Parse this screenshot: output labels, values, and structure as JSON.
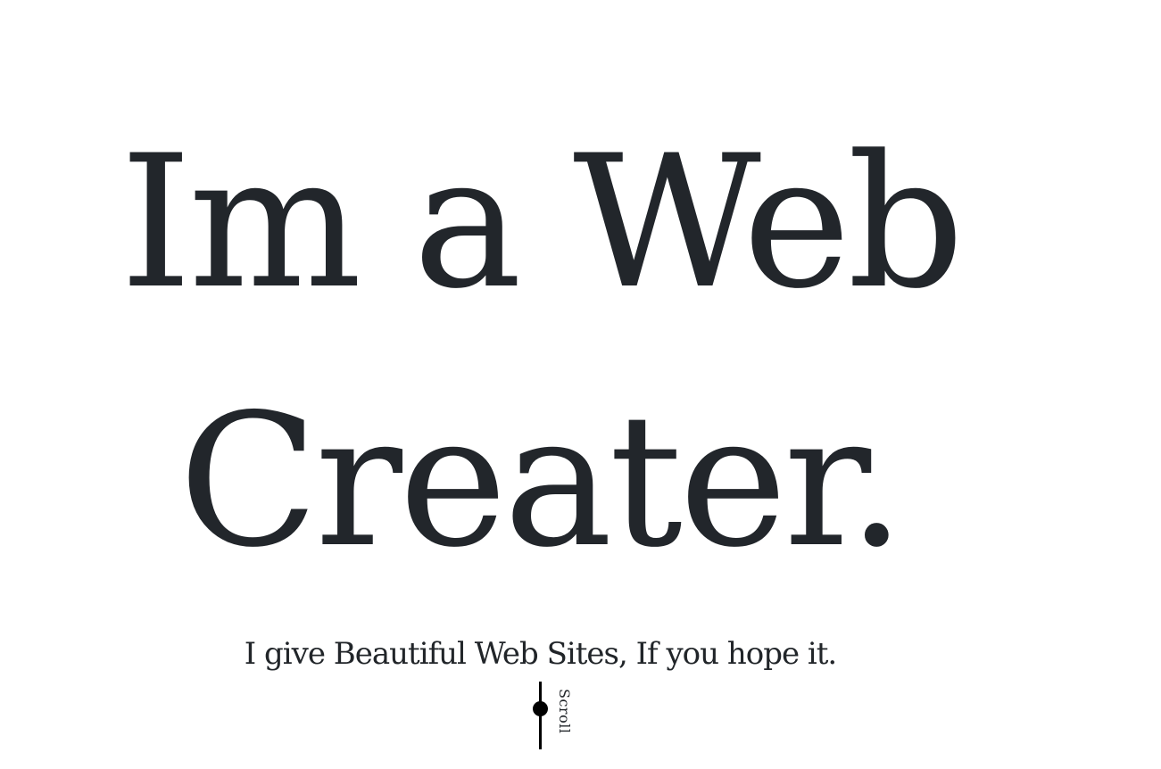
{
  "hero": {
    "headline_line1": "Im a Web",
    "headline_line2": "Creater.",
    "subtitle": "I give Beautiful Web Sites, If you hope it."
  },
  "scroll_indicator": {
    "label": "Scroll",
    "icon": "scroll-track-icon"
  },
  "colors": {
    "text": "#212529",
    "background": "#ffffff",
    "indicator": "#000000"
  }
}
